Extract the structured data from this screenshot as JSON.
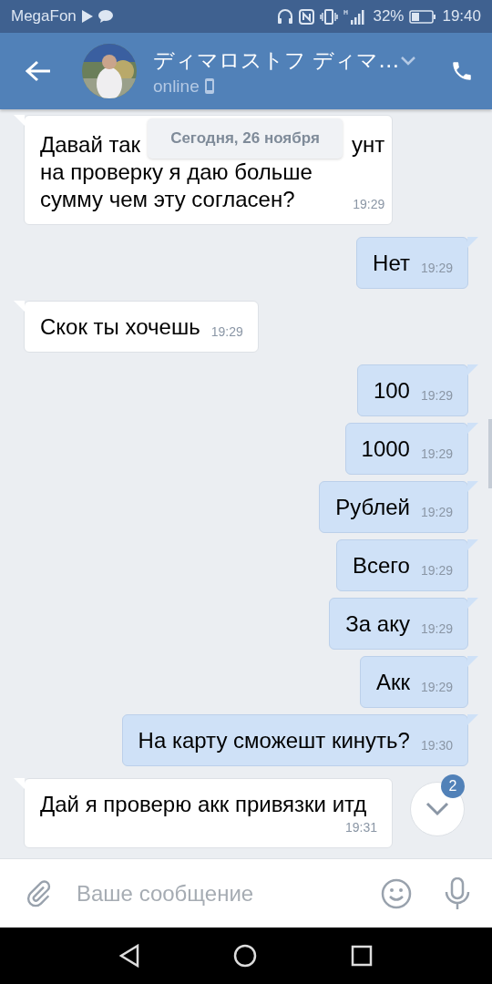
{
  "status_bar": {
    "carrier": "MegaFon",
    "battery": "32%",
    "time": "19:40"
  },
  "header": {
    "name": "ディマロストフ ディマ…",
    "status": "online"
  },
  "date_pill": "Сегодня, 26 ноября",
  "messages": [
    {
      "outgoing": false,
      "lines": [
        [
          "Давай так",
          "унт"
        ],
        [
          "на проверку я даю больше"
        ],
        [
          "сумму чем эту согласен?"
        ]
      ],
      "time": "19:29"
    },
    {
      "outgoing": true,
      "lines": [
        [
          "Нет"
        ]
      ],
      "time": "19:29"
    },
    {
      "outgoing": false,
      "lines": [
        [
          "Скок ты хочешь"
        ]
      ],
      "time": "19:29"
    },
    {
      "outgoing": true,
      "lines": [
        [
          "100"
        ]
      ],
      "time": "19:29"
    },
    {
      "outgoing": true,
      "lines": [
        [
          "1000"
        ]
      ],
      "time": "19:29"
    },
    {
      "outgoing": true,
      "lines": [
        [
          "Рублей"
        ]
      ],
      "time": "19:29"
    },
    {
      "outgoing": true,
      "lines": [
        [
          "Всего"
        ]
      ],
      "time": "19:29"
    },
    {
      "outgoing": true,
      "lines": [
        [
          "За аку"
        ]
      ],
      "time": "19:29"
    },
    {
      "outgoing": true,
      "lines": [
        [
          "Акк"
        ]
      ],
      "time": "19:29"
    },
    {
      "outgoing": true,
      "lines": [
        [
          "На карту сможешт кинуть?"
        ]
      ],
      "time": "19:30"
    },
    {
      "outgoing": false,
      "lines": [
        [
          "Дай я проверю акк привязки итд"
        ]
      ],
      "time": "19:31"
    }
  ],
  "unread_badge": "2",
  "composer": {
    "placeholder": "Ваше сообщение"
  }
}
